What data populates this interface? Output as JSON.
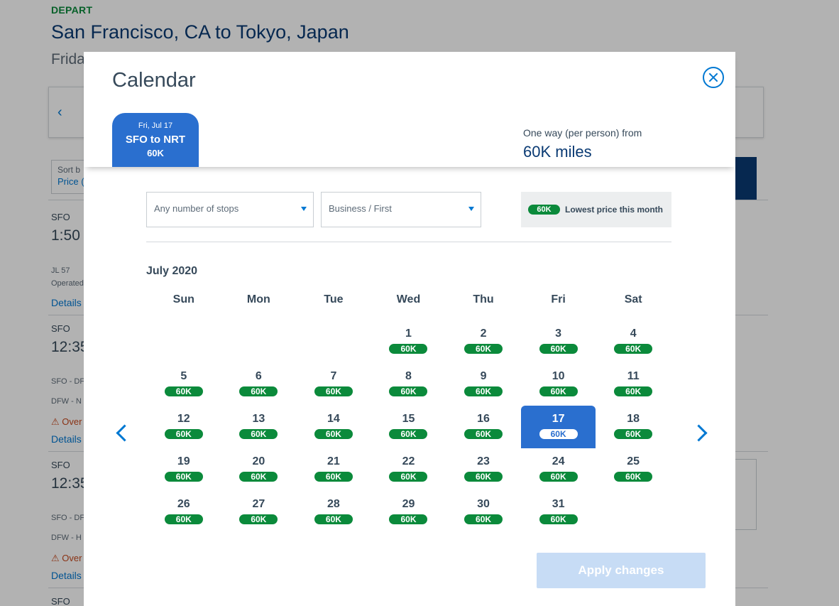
{
  "background": {
    "depart_label": "DEPART",
    "route_title": "San Francisco, CA to Tokyo, Japan",
    "route_date": "Frida",
    "carousel_prev_glyph": "‹",
    "sort_label": "Sort b",
    "sort_value": "Price (",
    "results": [
      {
        "airport": "SFO",
        "time": "1:50",
        "flight": "JL 57",
        "operated": "Operated",
        "details": "Details"
      },
      {
        "airport": "SFO",
        "time": "12:35",
        "leg1": "SFO - DF",
        "leg2": "DFW - N",
        "warning": "Over",
        "details": "Details"
      },
      {
        "airport": "SFO",
        "time": "12:35",
        "leg1": "SFO - DF",
        "leg2": "DFW - H",
        "warning": "Over",
        "details": "Details"
      },
      {
        "airport": "SFO"
      }
    ]
  },
  "modal": {
    "title": "Calendar",
    "trip_tab": {
      "date": "Fri, Jul 17",
      "route": "SFO to NRT",
      "price": "60K"
    },
    "oneway_label": "One way (per person) from",
    "oneway_price": "60K miles",
    "filters": {
      "stops": "Any number of stops",
      "cabin": "Business / First"
    },
    "legend": {
      "pill": "60K",
      "text": "Lowest price this month"
    },
    "month_label": "July 2020",
    "weekdays": [
      "Sun",
      "Mon",
      "Tue",
      "Wed",
      "Thu",
      "Fri",
      "Sat"
    ],
    "first_weekday_index": 3,
    "selected_day": 17,
    "days": [
      {
        "day": "1",
        "price": "60K"
      },
      {
        "day": "2",
        "price": "60K"
      },
      {
        "day": "3",
        "price": "60K"
      },
      {
        "day": "4",
        "price": "60K"
      },
      {
        "day": "5",
        "price": "60K"
      },
      {
        "day": "6",
        "price": "60K"
      },
      {
        "day": "7",
        "price": "60K"
      },
      {
        "day": "8",
        "price": "60K"
      },
      {
        "day": "9",
        "price": "60K"
      },
      {
        "day": "10",
        "price": "60K"
      },
      {
        "day": "11",
        "price": "60K"
      },
      {
        "day": "12",
        "price": "60K"
      },
      {
        "day": "13",
        "price": "60K"
      },
      {
        "day": "14",
        "price": "60K"
      },
      {
        "day": "15",
        "price": "60K"
      },
      {
        "day": "16",
        "price": "60K"
      },
      {
        "day": "17",
        "price": "60K"
      },
      {
        "day": "18",
        "price": "60K"
      },
      {
        "day": "19",
        "price": "60K"
      },
      {
        "day": "20",
        "price": "60K"
      },
      {
        "day": "21",
        "price": "60K"
      },
      {
        "day": "22",
        "price": "60K"
      },
      {
        "day": "23",
        "price": "60K"
      },
      {
        "day": "24",
        "price": "60K"
      },
      {
        "day": "25",
        "price": "60K"
      },
      {
        "day": "26",
        "price": "60K"
      },
      {
        "day": "27",
        "price": "60K"
      },
      {
        "day": "28",
        "price": "60K"
      },
      {
        "day": "29",
        "price": "60K"
      },
      {
        "day": "30",
        "price": "60K"
      },
      {
        "day": "31",
        "price": "60K"
      }
    ],
    "apply_label": "Apply changes",
    "icons": {
      "close": "close-circle-icon",
      "prev": "chevron-left-icon",
      "next": "chevron-right-icon",
      "caret": "caret-down-icon",
      "warning": "warning-icon"
    },
    "colors": {
      "accent": "#0078d2",
      "selected": "#2a6fcf",
      "price_pill": "#0b8a3b",
      "apply_disabled": "#c7dcf5"
    }
  }
}
